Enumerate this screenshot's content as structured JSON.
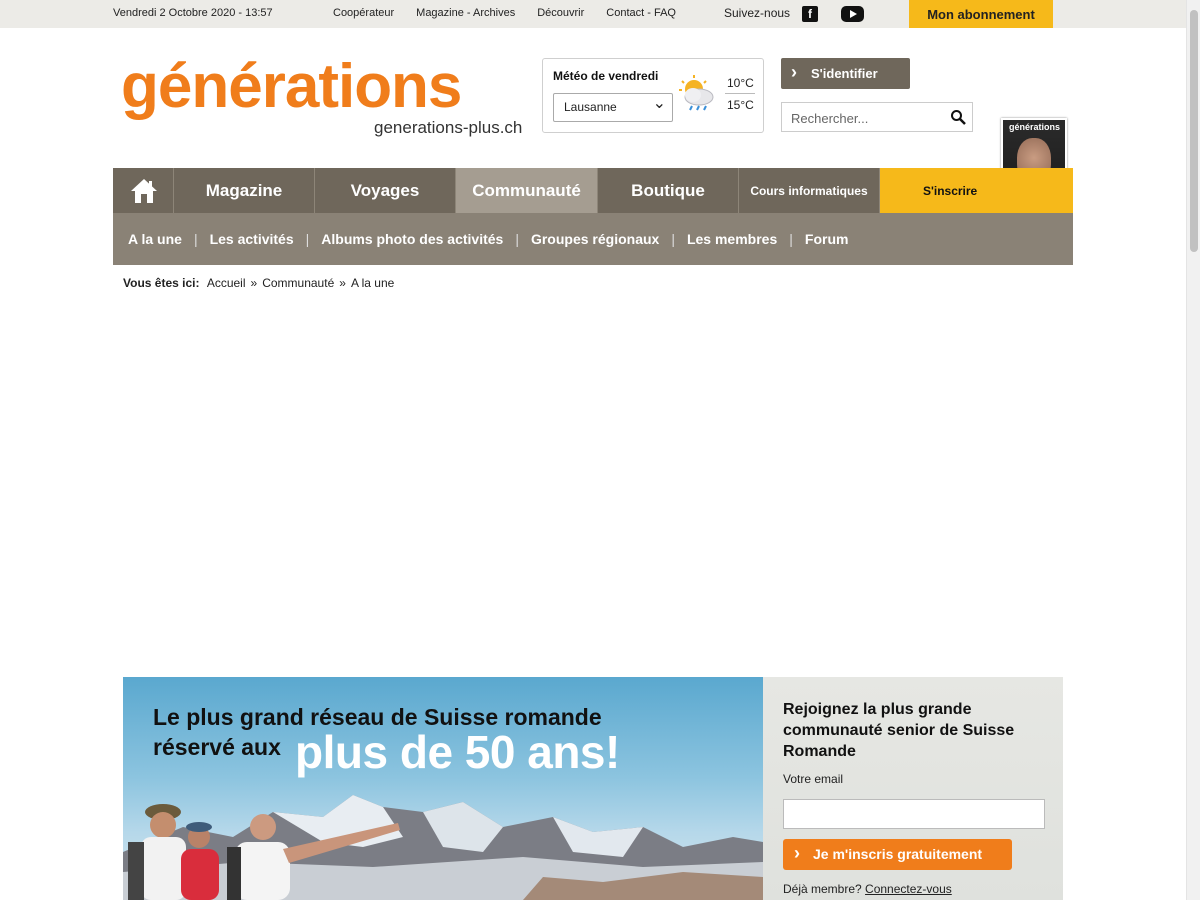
{
  "topbar": {
    "date": "Vendredi 2 Octobre 2020 - 13:57",
    "links": [
      "Coopérateur",
      "Magazine - Archives",
      "Découvrir",
      "Contact - FAQ"
    ],
    "follow": "Suivez-nous",
    "facebook_icon": "facebook-icon",
    "youtube_icon": "youtube-icon",
    "subscription": "Mon abonnement"
  },
  "header": {
    "logo": "générations",
    "logo_sub": "generations-plus.ch",
    "meteo": {
      "title": "Météo de vendredi",
      "city": "Lausanne",
      "temp_min": "10°C",
      "temp_max": "15°C",
      "icon": "cloud-sun-rain-icon"
    },
    "login": "S'identifier",
    "search_placeholder": "Rechercher...",
    "cover_title": "générations"
  },
  "mainnav": {
    "home_icon": "home-icon",
    "items": [
      "Magazine",
      "Voyages",
      "Communauté",
      "Boutique",
      "Cours informatiques",
      "S'inscrire"
    ],
    "active": "Communauté"
  },
  "subnav": {
    "items": [
      "A la une",
      "Les activités",
      "Albums photo des activités",
      "Groupes régionaux",
      "Les membres",
      "Forum"
    ]
  },
  "breadcrumb": {
    "label": "Vous êtes ici:",
    "items": [
      "Accueil",
      "Communauté",
      "A la une"
    ]
  },
  "banner": {
    "line1": "Le plus grand réseau de Suisse romande",
    "line2": "réservé aux",
    "highlight": "plus de 50 ans!"
  },
  "join": {
    "title": "Rejoignez la plus grande communauté senior de Suisse Romande",
    "email_label": "Votre email",
    "button": "Je m'inscris gratuitement",
    "member_text": "Déjà membre?",
    "member_link": "Connectez-vous"
  }
}
